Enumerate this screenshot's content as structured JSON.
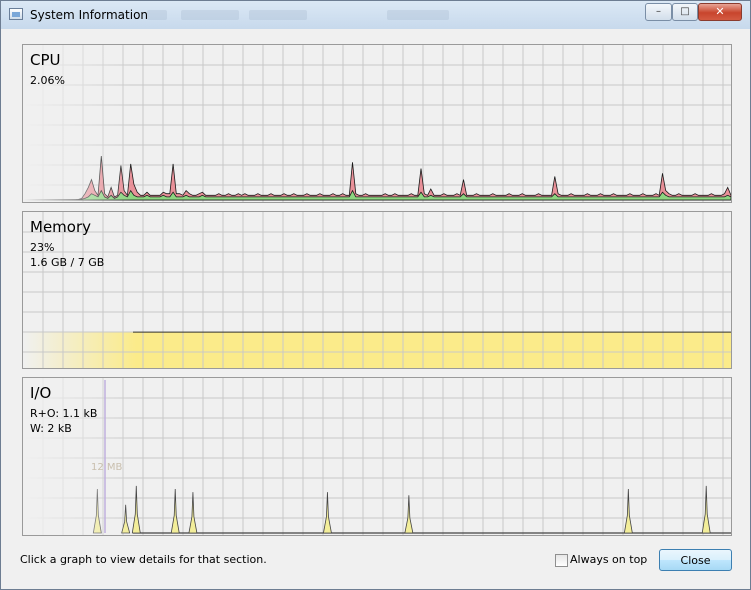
{
  "window": {
    "title": "System Information",
    "controls": {
      "minimize": "–",
      "maximize": "□",
      "close": "✕"
    }
  },
  "panels": {
    "cpu": {
      "title": "CPU",
      "usage": "2.06%"
    },
    "memory": {
      "title": "Memory",
      "percent": "23%",
      "amount": "1.6 GB / 7 GB",
      "fill_fraction": 0.23
    },
    "io": {
      "title": "I/O",
      "read_other": "R+O: 1.1 kB",
      "write": "W: 2 kB",
      "scale_label": "12 MB"
    }
  },
  "footer": {
    "hint": "Click a graph to view details for that section.",
    "always_on_top_label": "Always on top",
    "always_on_top_checked": false,
    "close_label": "Close"
  },
  "colors": {
    "grid": "#c8c8c8",
    "cpu_total": "#e8808a",
    "cpu_kernel": "#7be07b",
    "memory_fill": "#fbeb8a",
    "io_fill": "#f3ee9a",
    "io_line": "#444444",
    "io_other": "#b09ad8"
  },
  "series": {
    "cpu_total": [
      0.002,
      0.002,
      0.002,
      0.002,
      0.002,
      0.002,
      0.002,
      0.002,
      0.002,
      0.002,
      0.002,
      0.002,
      0.002,
      0.002,
      0.002,
      0.002,
      0.002,
      0.004,
      0.01,
      0.04,
      0.08,
      0.13,
      0.06,
      0.03,
      0.28,
      0.04,
      0.02,
      0.08,
      0.02,
      0.03,
      0.22,
      0.06,
      0.03,
      0.23,
      0.1,
      0.05,
      0.03,
      0.03,
      0.05,
      0.03,
      0.03,
      0.03,
      0.03,
      0.05,
      0.04,
      0.04,
      0.23,
      0.04,
      0.04,
      0.03,
      0.06,
      0.04,
      0.03,
      0.03,
      0.04,
      0.05,
      0.03,
      0.03,
      0.03,
      0.03,
      0.04,
      0.03,
      0.03,
      0.04,
      0.03,
      0.03,
      0.04,
      0.03,
      0.04,
      0.03,
      0.03,
      0.03,
      0.04,
      0.03,
      0.03,
      0.03,
      0.04,
      0.03,
      0.03,
      0.03,
      0.04,
      0.03,
      0.03,
      0.04,
      0.03,
      0.03,
      0.03,
      0.04,
      0.03,
      0.03,
      0.03,
      0.04,
      0.03,
      0.03,
      0.03,
      0.04,
      0.03,
      0.03,
      0.04,
      0.03,
      0.03,
      0.24,
      0.04,
      0.03,
      0.03,
      0.04,
      0.03,
      0.03,
      0.03,
      0.03,
      0.03,
      0.04,
      0.03,
      0.03,
      0.04,
      0.03,
      0.03,
      0.03,
      0.03,
      0.04,
      0.03,
      0.03,
      0.2,
      0.04,
      0.03,
      0.07,
      0.03,
      0.03,
      0.03,
      0.04,
      0.03,
      0.03,
      0.03,
      0.04,
      0.03,
      0.13,
      0.03,
      0.03,
      0.03,
      0.04,
      0.03,
      0.03,
      0.03,
      0.03,
      0.04,
      0.03,
      0.03,
      0.03,
      0.03,
      0.04,
      0.03,
      0.03,
      0.03,
      0.04,
      0.03,
      0.03,
      0.03,
      0.03,
      0.04,
      0.03,
      0.03,
      0.03,
      0.03,
      0.15,
      0.04,
      0.03,
      0.03,
      0.03,
      0.04,
      0.03,
      0.03,
      0.03,
      0.03,
      0.04,
      0.03,
      0.03,
      0.03,
      0.04,
      0.03,
      0.03,
      0.03,
      0.04,
      0.03,
      0.03,
      0.03,
      0.03,
      0.04,
      0.03,
      0.03,
      0.03,
      0.04,
      0.03,
      0.03,
      0.03,
      0.04,
      0.03,
      0.17,
      0.06,
      0.04,
      0.03,
      0.03,
      0.04,
      0.03,
      0.03,
      0.03,
      0.03,
      0.04,
      0.03,
      0.03,
      0.03,
      0.03,
      0.04,
      0.03,
      0.03,
      0.03,
      0.04,
      0.08,
      0.03
    ],
    "cpu_kernel": [
      0.001,
      0.001,
      0.001,
      0.001,
      0.001,
      0.001,
      0.001,
      0.001,
      0.001,
      0.001,
      0.001,
      0.001,
      0.001,
      0.001,
      0.001,
      0.001,
      0.001,
      0.002,
      0.005,
      0.01,
      0.02,
      0.04,
      0.03,
      0.02,
      0.06,
      0.02,
      0.01,
      0.03,
      0.01,
      0.02,
      0.05,
      0.03,
      0.02,
      0.06,
      0.03,
      0.02,
      0.02,
      0.02,
      0.03,
      0.02,
      0.02,
      0.02,
      0.02,
      0.03,
      0.02,
      0.02,
      0.05,
      0.02,
      0.02,
      0.02,
      0.03,
      0.02,
      0.02,
      0.02,
      0.02,
      0.03,
      0.02,
      0.02,
      0.02,
      0.02,
      0.02,
      0.02,
      0.02,
      0.02,
      0.02,
      0.02,
      0.02,
      0.02,
      0.02,
      0.02,
      0.02,
      0.02,
      0.02,
      0.02,
      0.02,
      0.02,
      0.02,
      0.02,
      0.02,
      0.02,
      0.02,
      0.02,
      0.02,
      0.02,
      0.02,
      0.02,
      0.02,
      0.02,
      0.02,
      0.02,
      0.02,
      0.02,
      0.02,
      0.02,
      0.02,
      0.02,
      0.02,
      0.02,
      0.02,
      0.02,
      0.02,
      0.06,
      0.02,
      0.02,
      0.02,
      0.02,
      0.02,
      0.02,
      0.02,
      0.02,
      0.02,
      0.02,
      0.02,
      0.02,
      0.02,
      0.02,
      0.02,
      0.02,
      0.02,
      0.02,
      0.02,
      0.02,
      0.05,
      0.02,
      0.02,
      0.03,
      0.02,
      0.02,
      0.02,
      0.02,
      0.02,
      0.02,
      0.02,
      0.02,
      0.02,
      0.04,
      0.02,
      0.02,
      0.02,
      0.02,
      0.02,
      0.02,
      0.02,
      0.02,
      0.02,
      0.02,
      0.02,
      0.02,
      0.02,
      0.02,
      0.02,
      0.02,
      0.02,
      0.02,
      0.02,
      0.02,
      0.02,
      0.02,
      0.02,
      0.02,
      0.02,
      0.02,
      0.02,
      0.04,
      0.02,
      0.02,
      0.02,
      0.02,
      0.02,
      0.02,
      0.02,
      0.02,
      0.02,
      0.02,
      0.02,
      0.02,
      0.02,
      0.02,
      0.02,
      0.02,
      0.02,
      0.02,
      0.02,
      0.02,
      0.02,
      0.02,
      0.02,
      0.02,
      0.02,
      0.02,
      0.02,
      0.02,
      0.02,
      0.02,
      0.02,
      0.02,
      0.05,
      0.03,
      0.02,
      0.02,
      0.02,
      0.02,
      0.02,
      0.02,
      0.02,
      0.02,
      0.02,
      0.02,
      0.02,
      0.02,
      0.02,
      0.02,
      0.02,
      0.02,
      0.02,
      0.02,
      0.03,
      0.02
    ],
    "io_spikes": [
      {
        "at": 0.105,
        "value": 0.28
      },
      {
        "at": 0.145,
        "value": 0.18
      },
      {
        "at": 0.16,
        "value": 0.3
      },
      {
        "at": 0.215,
        "value": 0.28
      },
      {
        "at": 0.24,
        "value": 0.26
      },
      {
        "at": 0.43,
        "value": 0.26
      },
      {
        "at": 0.545,
        "value": 0.24
      },
      {
        "at": 0.855,
        "value": 0.28
      },
      {
        "at": 0.965,
        "value": 0.3
      }
    ]
  }
}
